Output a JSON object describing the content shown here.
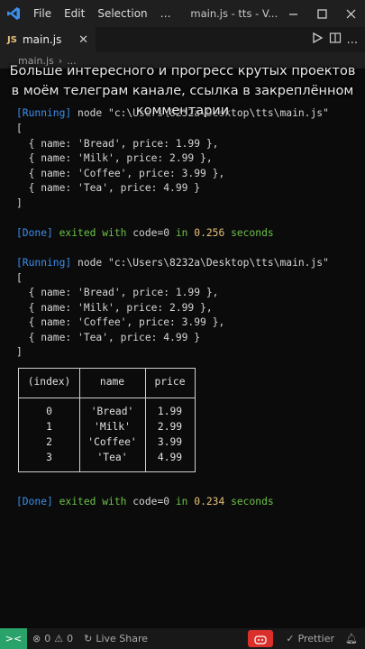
{
  "titlebar": {
    "menu": [
      "File",
      "Edit",
      "Selection"
    ],
    "more": "…",
    "window_title": "main.js - tts - V..."
  },
  "tab": {
    "label": "main.js",
    "js_icon": "JS",
    "close": "✕"
  },
  "breadcrumb": {
    "file": "main.js",
    "sep": "›",
    "more": "..."
  },
  "overlay": {
    "lines": [
      "Больше интересного и прогресс крутых проектов",
      "в моём телеграм канале, ссылка в закреплённом",
      "комментарии"
    ]
  },
  "terminal": {
    "run1": {
      "tag": "[Running]",
      "cmd": " node \"c:\\Users\\8232a\\Desktop\\tts\\main.js\""
    },
    "array_lines_1": [
      "[",
      "  { name: 'Bread', price: 1.99 },",
      "  { name: 'Milk', price: 2.99 },",
      "  { name: 'Coffee', price: 3.99 },",
      "  { name: 'Tea', price: 4.99 }",
      "]"
    ],
    "done1": {
      "tag": "[Done]",
      "text": " exited with ",
      "code": "code=0",
      "in": " in ",
      "time": "0.256",
      "unit": " seconds"
    },
    "run2": {
      "tag": "[Running]",
      "cmd": " node \"c:\\Users\\8232a\\Desktop\\tts\\main.js\""
    },
    "array_lines_2": [
      "[",
      "  { name: 'Bread', price: 1.99 },",
      "  { name: 'Milk', price: 2.99 },",
      "  { name: 'Coffee', price: 3.99 },",
      "  { name: 'Tea', price: 4.99 }",
      "]"
    ],
    "table": {
      "headers": [
        "(index)",
        "name",
        "price"
      ],
      "rows": [
        [
          "0",
          "'Bread'",
          "1.99"
        ],
        [
          "1",
          "'Milk'",
          "2.99"
        ],
        [
          "2",
          "'Coffee'",
          "3.99"
        ],
        [
          "3",
          "'Tea'",
          "4.99"
        ]
      ]
    },
    "done2": {
      "tag": "[Done]",
      "text": " exited with ",
      "code": "code=0",
      "in": " in ",
      "time": "0.234",
      "unit": " seconds"
    }
  },
  "statusbar": {
    "remote": "><",
    "errors": "0",
    "warnings": "0",
    "live_share": "Live Share",
    "prettier": "Prettier"
  },
  "colors": {
    "accent_blue": "#3b8eea",
    "green": "#6cc24a",
    "remote_green": "#2aa36b",
    "copilot_red": "#d9302c"
  }
}
